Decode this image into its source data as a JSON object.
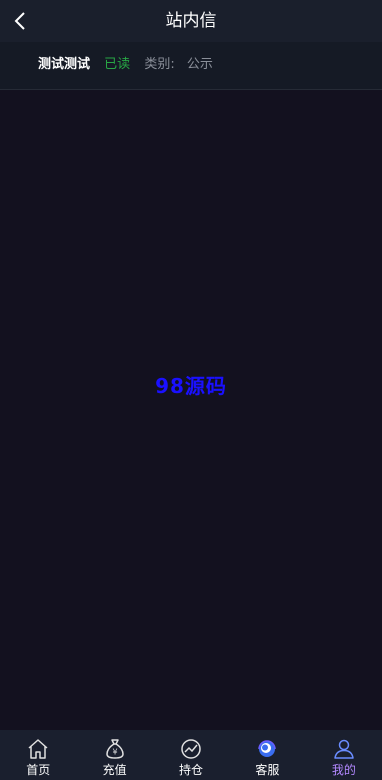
{
  "header": {
    "title": "站内信"
  },
  "message": {
    "title": "测试测试",
    "status": "已读",
    "category_label": "类别:",
    "category_value": "公示"
  },
  "watermark": "98源码",
  "tabbar": {
    "items": [
      {
        "label": "首页",
        "icon": "home-icon"
      },
      {
        "label": "充值",
        "icon": "money-bag-icon"
      },
      {
        "label": "持仓",
        "icon": "chart-icon"
      },
      {
        "label": "客服",
        "icon": "support-icon"
      },
      {
        "label": "我的",
        "icon": "user-icon",
        "active": true
      }
    ]
  }
}
